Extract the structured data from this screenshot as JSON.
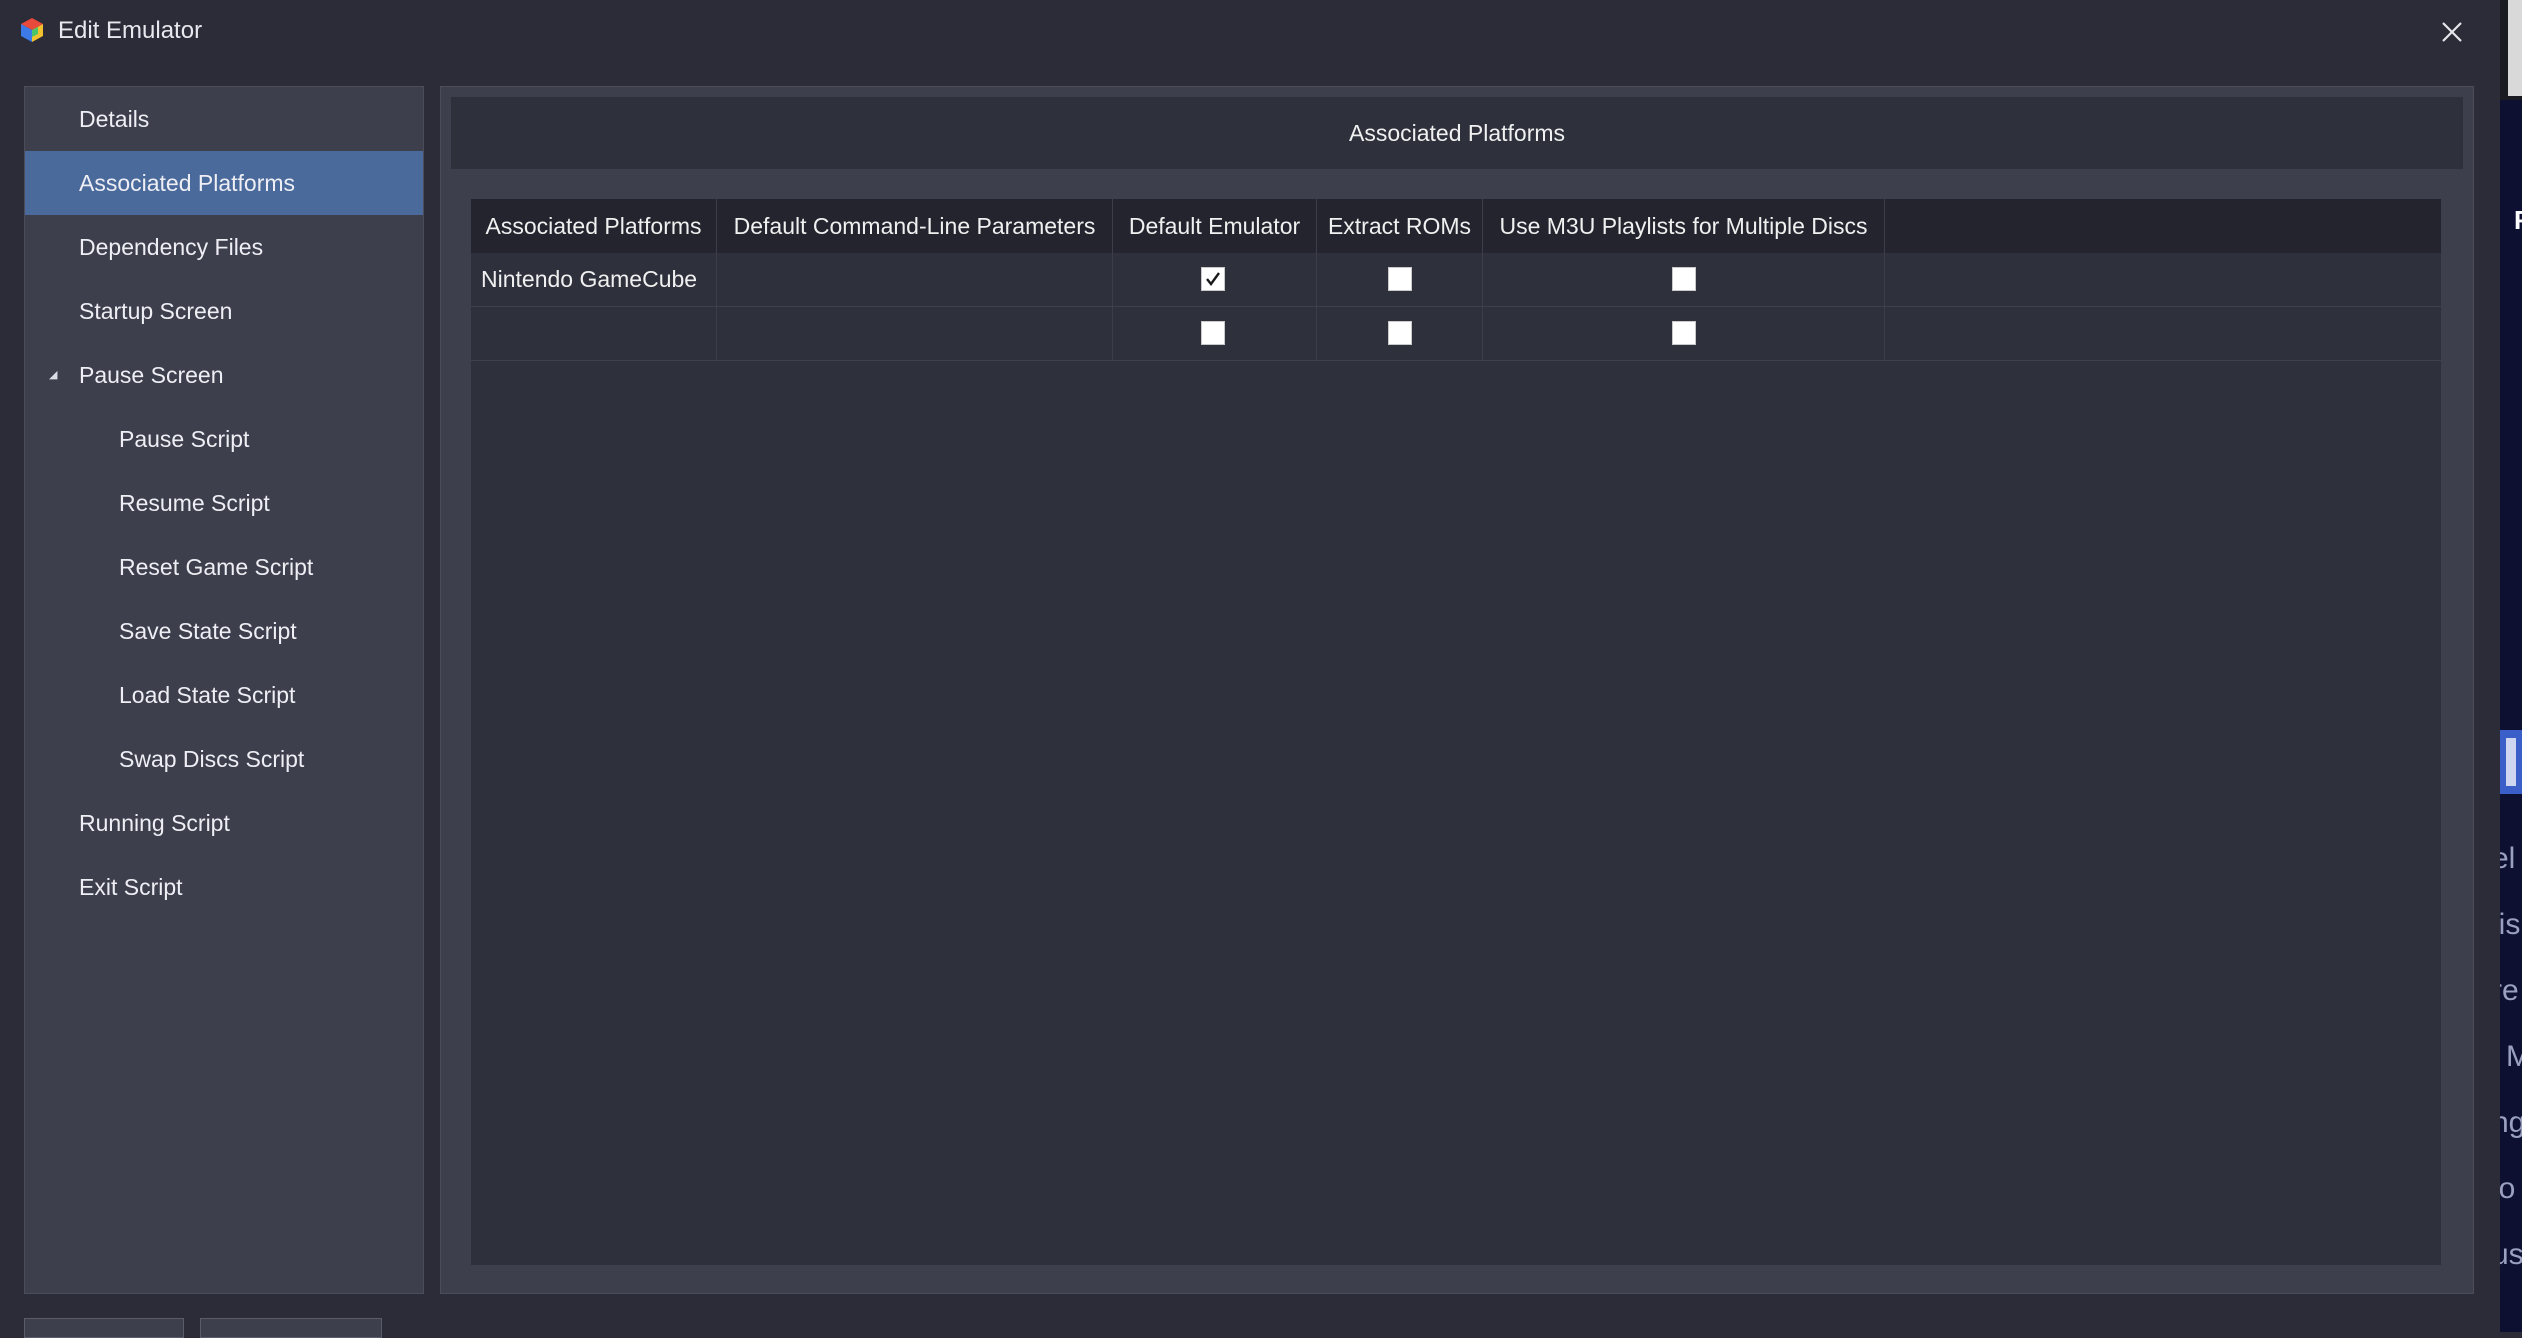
{
  "window": {
    "title": "Edit Emulator"
  },
  "nav": {
    "items": [
      {
        "label": "Details"
      },
      {
        "label": "Associated Platforms",
        "selected": true
      },
      {
        "label": "Dependency Files"
      },
      {
        "label": "Startup Screen"
      },
      {
        "label": "Pause Screen",
        "expanded": true
      },
      {
        "label": "Pause Script"
      },
      {
        "label": "Resume Script"
      },
      {
        "label": "Reset Game Script"
      },
      {
        "label": "Save State Script"
      },
      {
        "label": "Load State Script"
      },
      {
        "label": "Swap Discs Script"
      },
      {
        "label": "Running Script"
      },
      {
        "label": "Exit Script"
      }
    ]
  },
  "panel": {
    "title": "Associated Platforms",
    "columns": [
      "Associated Platforms",
      "Default Command-Line Parameters",
      "Default Emulator",
      "Extract ROMs",
      "Use M3U Playlists for Multiple Discs"
    ],
    "rows": [
      {
        "platform": "Nintendo GameCube",
        "params": "",
        "default_emulator": true,
        "extract_roms": false,
        "use_m3u": false
      },
      {
        "platform": "",
        "params": "",
        "default_emulator": false,
        "extract_roms": false,
        "use_m3u": false
      }
    ]
  },
  "background_window": {
    "fragments": [
      "F",
      "el",
      "lis",
      "re",
      "M",
      "ng",
      "io",
      "us"
    ]
  },
  "colors": {
    "window_bg": "#2b2c38",
    "panel_bg": "#3d3f4d",
    "selected_bg": "#4a6a9b",
    "grid_bg": "#2e303c",
    "header_bg": "#23242e"
  }
}
